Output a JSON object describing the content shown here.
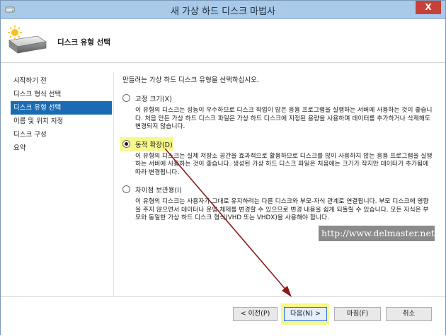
{
  "window": {
    "title": "새 가상 하드 디스크 마법사",
    "close_label": "X"
  },
  "header": {
    "title": "디스크 유형 선택"
  },
  "steps": [
    {
      "label": "시작하기 전",
      "active": false
    },
    {
      "label": "디스크 형식 선택",
      "active": false
    },
    {
      "label": "디스크 유형 선택",
      "active": true
    },
    {
      "label": "이름 및 위치 지정",
      "active": false
    },
    {
      "label": "디스크 구성",
      "active": false
    },
    {
      "label": "요약",
      "active": false
    }
  ],
  "content": {
    "intro": "만들려는 가상 하드 디스크 유형을 선택하십시오.",
    "options": [
      {
        "label": "고정 크기(X)",
        "checked": false,
        "description": "이 유형의 디스크는 성능이 우수하므로 디스크 작업이 많은 응용 프로그램을 실행하는 서버에 사용하는 것이 좋습니다. 처음 만든 가상 하드 디스크 파일은 가상 하드 디스크에 지정된 용량을 사용하며 데이터를 추가하거나 삭제해도 변경되지 않습니다."
      },
      {
        "label": "동적 확장(D)",
        "checked": true,
        "description": "이 유형의 디스크는 실제 저장소 공간을 효과적으로 활용하므로 디스크를 많이 사용하지 않는 응용 프로그램을 실행하는 서버에 사용하는 것이 좋습니다. 생성된 가상 하드 디스크 파일은 처음에는 크기가 작지만 데이터가 추가됨에 따라 변경됩니다."
      },
      {
        "label": "차이점 보관용(I)",
        "checked": false,
        "description": "이 유형의 디스크는 사용자가 그대로 유지하려는 다른 디스크와 부모-자식 관계로 연결됩니다. 부모 디스크에 영향을 주지 않으면서 데이터나 운영 체제를 변경할 수 있으므로 변경 내용을 쉽게 되돌릴 수 있습니다. 모든 자식은 부모와 동일한 가상 하드 디스크 형식(VHD 또는 VHDX)을 사용해야 합니다."
      }
    ]
  },
  "watermark": "http://www.delmaster.net",
  "buttons": {
    "previous": "< 이전(P)",
    "next": "다음(N) >",
    "finish": "마침(F)",
    "cancel": "취소"
  },
  "colors": {
    "titlebar": "#a9c9e9",
    "close": "#c7403a",
    "active_step": "#1a6bb4",
    "highlight": "#f6f98a",
    "arrow": "#8b1a1a"
  }
}
